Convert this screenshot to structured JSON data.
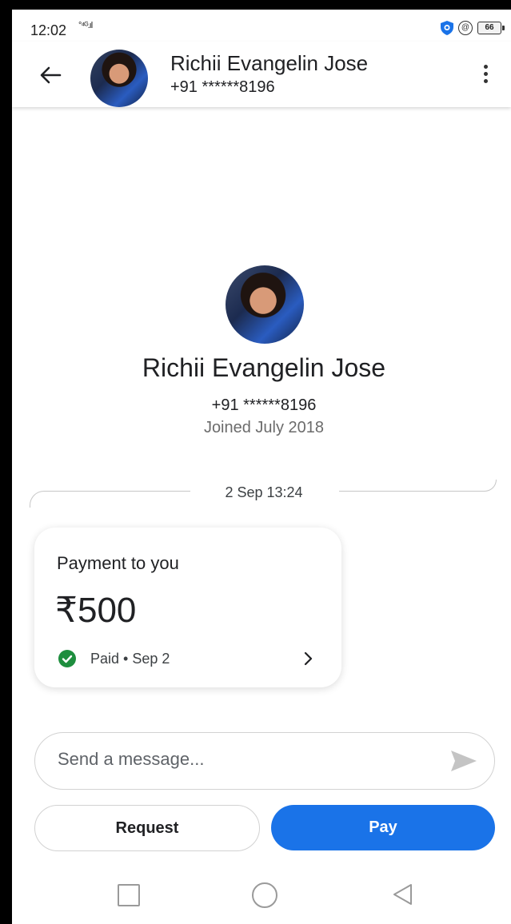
{
  "status_bar": {
    "time": "12:02",
    "signal": "°⁴ᴳ.ıl",
    "battery": "66"
  },
  "header": {
    "contact_name": "Richii Evangelin Jose",
    "contact_phone": "+91 ******8196"
  },
  "profile": {
    "name": "Richii Evangelin Jose",
    "phone": "+91 ******8196",
    "joined": "Joined July 2018"
  },
  "conversation": {
    "date_label": "2 Sep 13:24",
    "payment": {
      "title": "Payment to you",
      "amount": "₹500",
      "status": "Paid • Sep 2",
      "status_color": "#1e8e3e"
    }
  },
  "composer": {
    "placeholder": "Send a message..."
  },
  "actions": {
    "request_label": "Request",
    "pay_label": "Pay",
    "pay_color": "#1a73e8"
  }
}
